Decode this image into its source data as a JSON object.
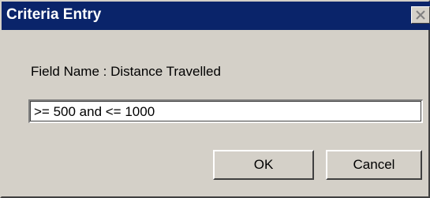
{
  "window": {
    "title": "Criteria Entry",
    "close_icon": "close-icon"
  },
  "form": {
    "field_label": "Field Name : Distance Travelled",
    "criteria_value": ">= 500 and <= 1000"
  },
  "buttons": {
    "ok_label": "OK",
    "cancel_label": "Cancel"
  },
  "colors": {
    "titlebar": "#0a246a",
    "face": "#d4d0c8"
  }
}
